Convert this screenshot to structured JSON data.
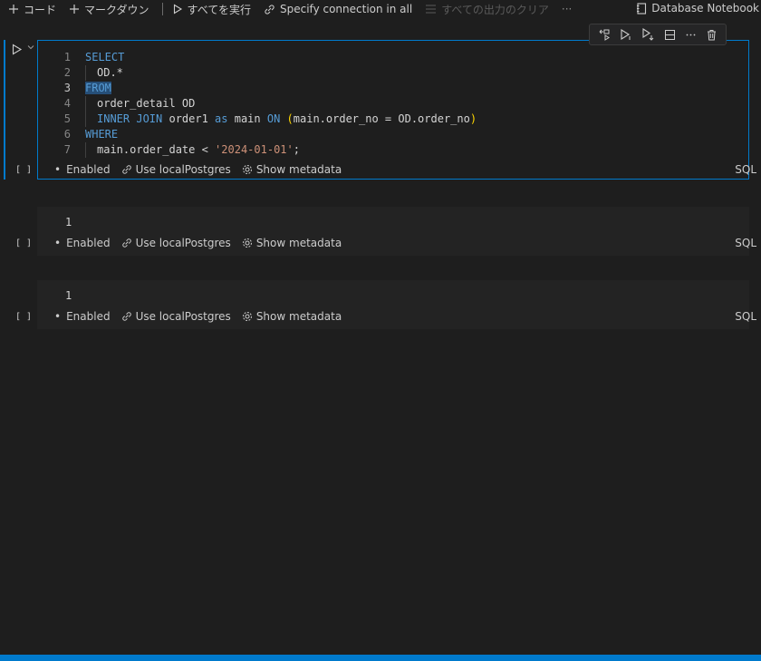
{
  "toolbar": {
    "code_label": "コード",
    "markdown_label": "マークダウン",
    "run_all_label": "すべてを実行",
    "specify_connection_label": "Specify connection in all",
    "clear_outputs_label": "すべての出力のクリア",
    "more_label": "···",
    "kernel_label": "Database Notebook"
  },
  "cells": [
    {
      "exec_count": "[ ]",
      "lines": [
        {
          "num": "1"
        },
        {
          "num": "2"
        },
        {
          "num": "3"
        },
        {
          "num": "4"
        },
        {
          "num": "5"
        },
        {
          "num": "6"
        },
        {
          "num": "7"
        }
      ],
      "tokens": {
        "l1": "SELECT",
        "l2": "OD.*",
        "l3": "FROM",
        "l4": "order_detail OD",
        "l5_kw1": "INNER JOIN",
        "l5_t1": " order1 ",
        "l5_kw2": "as",
        "l5_t2": " main ",
        "l5_kw3": "ON",
        "l5_t3": " ",
        "l5_p1": "(",
        "l5_t4": "main.order_no = OD.order_no",
        "l5_p2": ")",
        "l6": "WHERE",
        "l7_t1": "main.order_date < ",
        "l7_str": "'2024-01-01'",
        "l7_t2": ";"
      },
      "status": {
        "enabled": "Enabled",
        "connection": "Use localPostgres",
        "metadata": "Show metadata"
      },
      "language": "SQL"
    },
    {
      "exec_count": "[ ]",
      "content": "1",
      "status": {
        "enabled": "Enabled",
        "connection": "Use localPostgres",
        "metadata": "Show metadata"
      },
      "language": "SQL"
    },
    {
      "exec_count": "[ ]",
      "content": "1",
      "status": {
        "enabled": "Enabled",
        "connection": "Use localPostgres",
        "metadata": "Show metadata"
      },
      "language": "SQL"
    }
  ],
  "colors": {
    "accent": "#007acc",
    "keyword": "#569cd6",
    "string": "#ce9178",
    "background": "#1e1e1e"
  },
  "icons": [
    "plus-icon",
    "play-icon",
    "link-icon",
    "clear-icon",
    "notebook-icon",
    "gear-icon",
    "trash-icon",
    "split-icon",
    "chevron-down-icon"
  ]
}
